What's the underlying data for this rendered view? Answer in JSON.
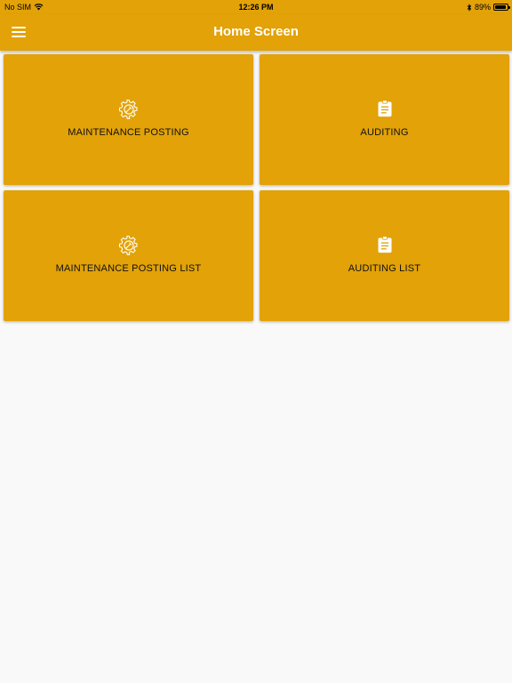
{
  "status_bar": {
    "carrier": "No SIM",
    "time": "12:26 PM",
    "battery": "89%",
    "battery_level": 0.89
  },
  "app_bar": {
    "title": "Home Screen",
    "menu_icon": "hamburger-menu-icon"
  },
  "colors": {
    "primary": "#e2a208",
    "background": "#f9f9f9",
    "title_text": "#ffffff"
  },
  "cards": [
    {
      "label": "MAINTENANCE POSTING",
      "icon": "gear-wrench-icon"
    },
    {
      "label": "AUDITING",
      "icon": "clipboard-icon"
    },
    {
      "label": "MAINTENANCE POSTING LIST",
      "icon": "gear-wrench-icon"
    },
    {
      "label": "AUDITING LIST",
      "icon": "clipboard-icon"
    }
  ]
}
